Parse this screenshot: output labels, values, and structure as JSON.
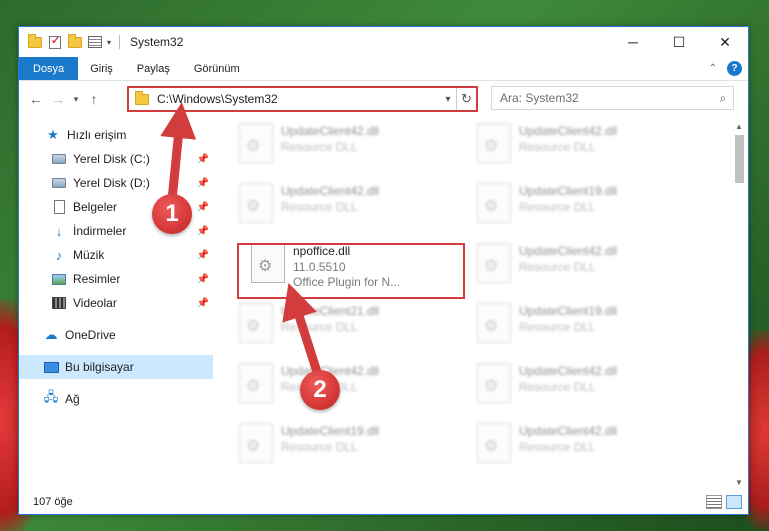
{
  "window": {
    "title": "System32"
  },
  "ribbon": {
    "tabs": [
      "Dosya",
      "Giriş",
      "Paylaş",
      "Görünüm"
    ],
    "help": "?",
    "collapse": "⌃"
  },
  "nav": {
    "back": "←",
    "forward": "→",
    "recent": "▾",
    "up": "↑"
  },
  "address": {
    "path": "C:\\Windows\\System32",
    "dropdown": "▾",
    "refresh": "↻"
  },
  "search": {
    "placeholder": "Ara: System32"
  },
  "sidebar": {
    "items": [
      {
        "label": "Hızlı erişim",
        "icon": "star-icon"
      },
      {
        "label": "Yerel Disk (C:)",
        "icon": "drive-icon"
      },
      {
        "label": "Yerel Disk (D:)",
        "icon": "drive-icon"
      },
      {
        "label": "Belgeler",
        "icon": "documents-icon"
      },
      {
        "label": "İndirmeler",
        "icon": "download-icon"
      },
      {
        "label": "Müzik",
        "icon": "music-icon"
      },
      {
        "label": "Resimler",
        "icon": "pictures-icon"
      },
      {
        "label": "Videolar",
        "icon": "videos-icon"
      },
      {
        "label": "OneDrive",
        "icon": "cloud-icon"
      },
      {
        "label": "Bu bilgisayar",
        "icon": "computer-icon"
      },
      {
        "label": "Ağ",
        "icon": "network-icon"
      }
    ]
  },
  "files": [
    {
      "name": "UpdateClient42.dll",
      "meta": "Resource DLL"
    },
    {
      "name": "UpdateClient42.dll",
      "meta": "Resource DLL"
    },
    {
      "name": "UpdateClient42.dll",
      "meta": "Resource DLL"
    },
    {
      "name": "UpdateClient19.dll",
      "meta": "Resource DLL"
    },
    {
      "name": "npoffice.dll",
      "meta": "11.0.5510",
      "meta2": "Office Plugin for N..."
    },
    {
      "name": "UpdateClient42.dll",
      "meta": "Resource DLL"
    },
    {
      "name": "UpdateClient21.dll",
      "meta": "Resource DLL"
    },
    {
      "name": "UpdateClient19.dll",
      "meta": "Resource DLL"
    },
    {
      "name": "UpdateClient42.dll",
      "meta": "Resource DLL"
    },
    {
      "name": "UpdateClient42.dll",
      "meta": "Resource DLL"
    },
    {
      "name": "UpdateClient19.dll",
      "meta": "Resource DLL"
    },
    {
      "name": "UpdateClient42.dll",
      "meta": "Resource DLL"
    }
  ],
  "status": {
    "count": "107 öğe"
  },
  "annotations": {
    "step1": "1",
    "step2": "2",
    "color": "#d33c3c"
  }
}
